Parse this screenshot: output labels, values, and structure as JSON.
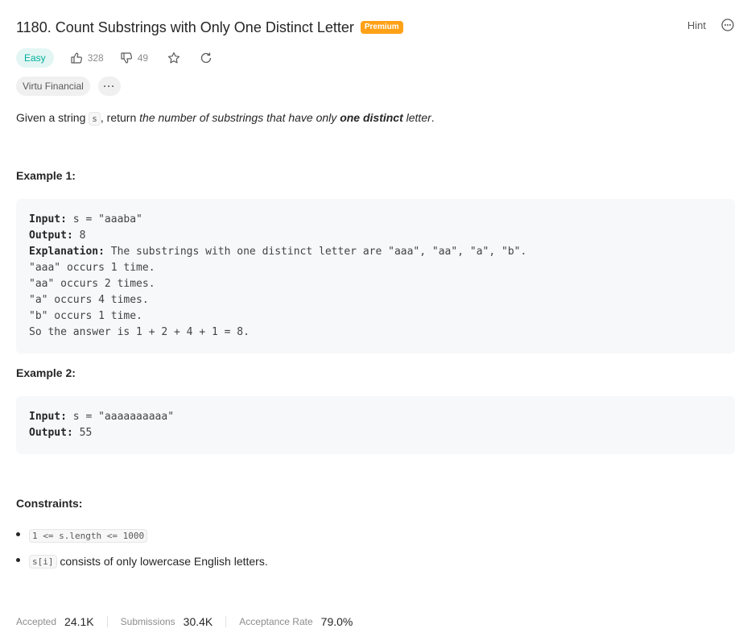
{
  "problem": {
    "title": "1180. Count Substrings with Only One Distinct Letter",
    "premium_label": "Premium",
    "hint_label": "Hint",
    "difficulty": "Easy",
    "likes": "328",
    "dislikes": "49",
    "company_tag": "Virtu Financial",
    "more_tags": "···"
  },
  "description": {
    "part1": "Given a string ",
    "code": "s",
    "part2": ", return ",
    "italic1": "the number of substrings that have only ",
    "bold": "one distinct",
    "italic2": " letter",
    "end": "."
  },
  "examples": [
    {
      "heading": "Example 1:",
      "input_label": "Input:",
      "input_value": " s = \"aaaba\"",
      "output_label": "Output:",
      "output_value": " 8",
      "explanation_label": "Explanation:",
      "explanation_value": " The substrings with one distinct letter are \"aaa\", \"aa\", \"a\", \"b\".",
      "extra_lines": [
        "\"aaa\" occurs 1 time.",
        "\"aa\" occurs 2 times.",
        "\"a\" occurs 4 times.",
        "\"b\" occurs 1 time.",
        "So the answer is 1 + 2 + 4 + 1 = 8."
      ]
    },
    {
      "heading": "Example 2:",
      "input_label": "Input:",
      "input_value": " s = \"aaaaaaaaaa\"",
      "output_label": "Output:",
      "output_value": " 55"
    }
  ],
  "constraints": {
    "heading": "Constraints:",
    "item1_code": "1 <= s.length <= 1000",
    "item2_code": "s[i]",
    "item2_text": " consists of only lowercase English letters."
  },
  "stats": {
    "accepted_label": "Accepted",
    "accepted_value": "24.1K",
    "submissions_label": "Submissions",
    "submissions_value": "30.4K",
    "rate_label": "Acceptance Rate",
    "rate_value": "79.0%"
  },
  "colors": {
    "premium": "#ffa116",
    "easy": "#00af9b",
    "easy_bg": "#e3f6f4"
  }
}
